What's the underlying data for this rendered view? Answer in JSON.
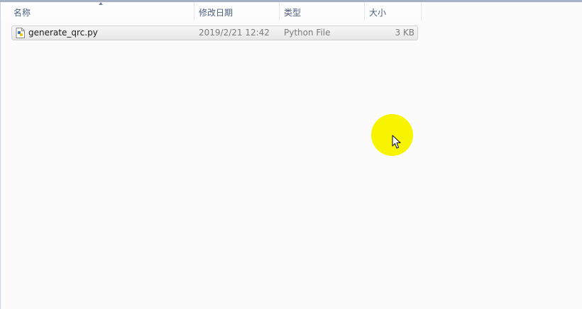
{
  "columns": [
    {
      "label": "名称"
    },
    {
      "label": "修改日期"
    },
    {
      "label": "类型"
    },
    {
      "label": "大小"
    }
  ],
  "files": [
    {
      "name": "generate_qrc.py",
      "modified": "2019/2/21 12:42",
      "type": "Python File",
      "size": "3 KB",
      "icon": "python-file-icon"
    }
  ],
  "sort": {
    "column": "名称",
    "direction": "ascending"
  },
  "colors": {
    "header_text": "#4b5f80",
    "highlight": "#f8f400",
    "selected_row": "#e7e7e7"
  }
}
